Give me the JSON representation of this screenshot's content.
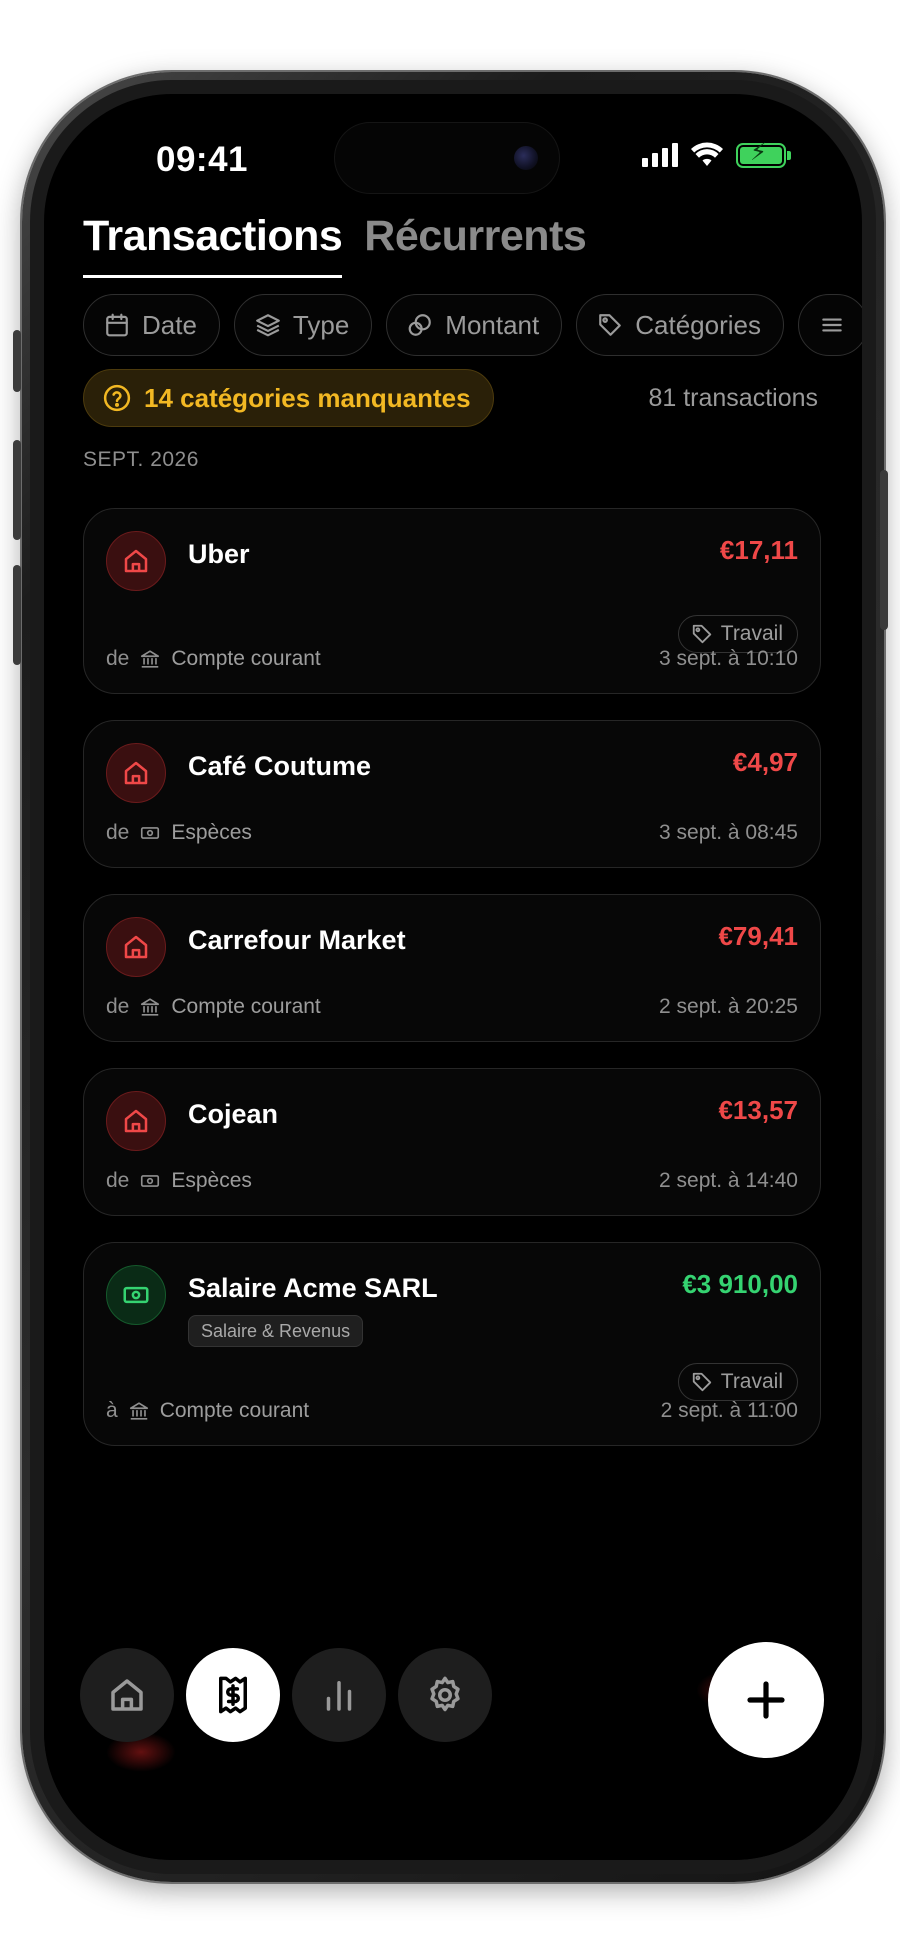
{
  "status_bar": {
    "time": "09:41"
  },
  "tabs": [
    {
      "label": "Transactions",
      "active": true
    },
    {
      "label": "Récurrents",
      "active": false
    }
  ],
  "filters": [
    {
      "label": "Date",
      "icon": "calendar-icon"
    },
    {
      "label": "Type",
      "icon": "layers-icon"
    },
    {
      "label": "Montant",
      "icon": "coins-icon"
    },
    {
      "label": "Catégories",
      "icon": "tag-icon"
    }
  ],
  "missing_categories": "14 catégories manquantes",
  "transactions_count": "81 transactions",
  "month_header": "SEPT. 2026",
  "transactions": [
    {
      "merchant": "Uber",
      "amount": "€17,11",
      "type": "expense",
      "tag": "Travail",
      "prefix": "de",
      "account": "Compte courant",
      "account_icon": "bank-icon",
      "date": "3 sept. à 10:10"
    },
    {
      "merchant": "Café Coutume",
      "amount": "€4,97",
      "type": "expense",
      "prefix": "de",
      "account": "Espèces",
      "account_icon": "cash-icon",
      "date": "3 sept. à 08:45"
    },
    {
      "merchant": "Carrefour Market",
      "amount": "€79,41",
      "type": "expense",
      "prefix": "de",
      "account": "Compte courant",
      "account_icon": "bank-icon",
      "date": "2 sept. à 20:25"
    },
    {
      "merchant": "Cojean",
      "amount": "€13,57",
      "type": "expense",
      "prefix": "de",
      "account": "Espèces",
      "account_icon": "cash-icon",
      "date": "2 sept. à 14:40"
    },
    {
      "merchant": "Salaire Acme SARL",
      "amount": "€3 910,00",
      "type": "income",
      "category": "Salaire & Revenus",
      "tag": "Travail",
      "prefix": "à",
      "account": "Compte courant",
      "account_icon": "bank-icon",
      "date": "2 sept. à 11:00"
    }
  ],
  "nav": [
    {
      "name": "home",
      "icon": "home-icon",
      "active": false
    },
    {
      "name": "transactions",
      "icon": "receipt-icon",
      "active": true
    },
    {
      "name": "stats",
      "icon": "bar-chart-icon",
      "active": false
    },
    {
      "name": "settings",
      "icon": "gear-icon",
      "active": false
    }
  ],
  "colors": {
    "expense": "#ef4848",
    "income": "#35d371",
    "warning": "#f2b823",
    "background": "#000000"
  }
}
